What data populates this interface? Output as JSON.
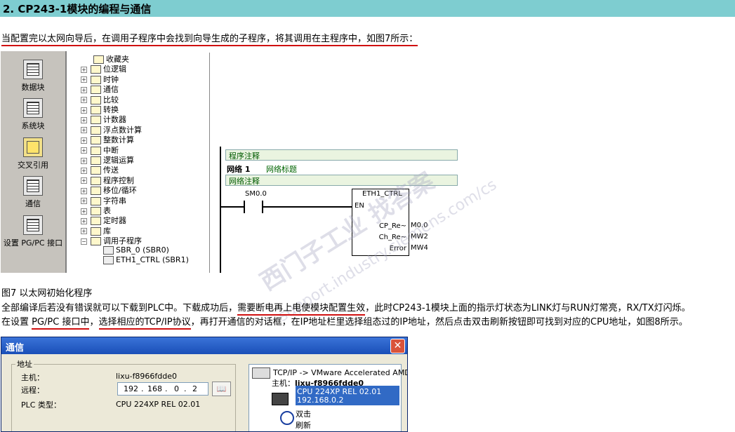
{
  "section": {
    "title": "2. CP243-1模块的编程与通信"
  },
  "para1": "当配置完以太网向导后，在调用子程序中会找到向导生成的子程序，将其调用在主程序中，如图7所示：",
  "fig7": {
    "left_bar": [
      "数据块",
      "系统块",
      "交叉引用",
      "通信",
      "设置 PG/PC 接口"
    ],
    "tree": [
      {
        "label": "收藏夹",
        "icon": "star-icon"
      },
      {
        "label": "位逻辑",
        "icon": "bit-icon"
      },
      {
        "label": "时钟",
        "icon": "clock-icon"
      },
      {
        "label": "通信",
        "icon": "comm-icon"
      },
      {
        "label": "比较",
        "icon": "compare-icon"
      },
      {
        "label": "转换",
        "icon": "convert-icon"
      },
      {
        "label": "计数器",
        "icon": "counter-icon"
      },
      {
        "label": "浮点数计算",
        "icon": "float-icon"
      },
      {
        "label": "整数计算",
        "icon": "int-icon"
      },
      {
        "label": "中断",
        "icon": "interrupt-icon"
      },
      {
        "label": "逻辑运算",
        "icon": "logic-icon"
      },
      {
        "label": "传送",
        "icon": "move-icon"
      },
      {
        "label": "程序控制",
        "icon": "program-icon"
      },
      {
        "label": "移位/循环",
        "icon": "shift-icon"
      },
      {
        "label": "字符串",
        "icon": "string-icon"
      },
      {
        "label": "表",
        "icon": "table-icon"
      },
      {
        "label": "定时器",
        "icon": "timer-icon"
      },
      {
        "label": "库",
        "icon": "library-icon"
      },
      {
        "label": "调用子程序",
        "icon": "call-icon"
      }
    ],
    "subroutines": [
      "SBR_0 (SBR0)",
      "ETH1_CTRL (SBR1)"
    ],
    "ladder": {
      "program_comment": "程序注释",
      "network_label": "网络 1",
      "network_title": "网络标题",
      "network_comment": "网络注释",
      "contact": "SM0.0",
      "block_name": "ETH1_CTRL",
      "en": "EN",
      "outputs": [
        {
          "pin": "CP_Re~",
          "addr": "M0.0"
        },
        {
          "pin": "Ch_Re~",
          "addr": "MW2"
        },
        {
          "pin": "Error",
          "addr": "MW4"
        }
      ]
    },
    "watermark": "西门子工业 找答案",
    "watermark_url": "support.industry.siemens.com/cs"
  },
  "fig7_caption": "图7 以太网初始化程序",
  "para2": {
    "a": "全部编译后若没有错误就可以下载到PLC中。下载成功后，",
    "b": "需要断电再上电使模块配置生效",
    "c": "，此时CP243-1模块上面的指示灯状态为LINK灯与RUN灯常亮，RX/TX灯闪烁。"
  },
  "para3": {
    "a": "在设置 ",
    "b": "PG/PC 接口中",
    "c": "，",
    "d": "选择相应的TCP/IP协议",
    "e": "，再打开通信的对话框，在IP地址栏里选择组态过的IP地址，然后点击双击刷新按钮即可找到对应的CPU地址，如图8所示。"
  },
  "dialog": {
    "title": "通信",
    "close": "✕",
    "group": "地址",
    "host_label": "主机：",
    "host_value": "lixu-f8966fdde0",
    "remote_label": "远程：",
    "ip": [
      "192",
      "168",
      "0",
      "2"
    ],
    "plc_label": "PLC 类型：",
    "plc_value": "CPU 224XP REL 02.01",
    "tree_line1": "TCP/IP -> VMware Accelerated AMD...",
    "tree_host_label": "主机：",
    "tree_host_value": "lixu-f8966fdde0",
    "cpu_line1": "CPU 224XP REL 02.01",
    "cpu_line2": "192.168.0.2",
    "refresh_line1": "双击",
    "refresh_line2": "刷新"
  }
}
